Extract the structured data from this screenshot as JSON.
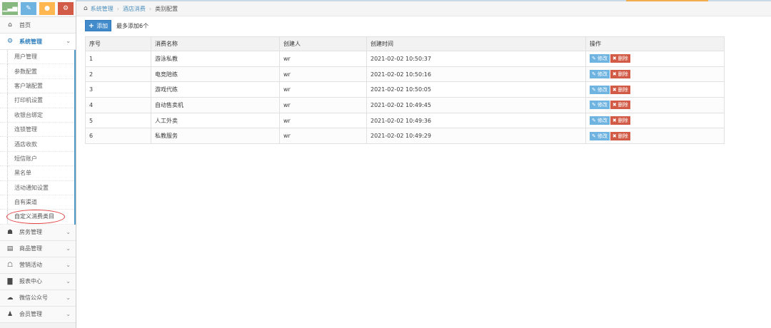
{
  "shortcuts": [
    {
      "icon": "chart-icon",
      "glyph": "▁▃▅",
      "color": "#87b87f"
    },
    {
      "icon": "pencil-icon",
      "glyph": "✎",
      "color": "#6fb3e0"
    },
    {
      "icon": "users-icon",
      "glyph": "●",
      "color": "#ffb752"
    },
    {
      "icon": "cogs-icon",
      "glyph": "⚙",
      "color": "#d15b47"
    }
  ],
  "nav": {
    "home": {
      "label": "首页",
      "icon": "home-icon",
      "glyph": "⌂"
    },
    "system": {
      "label": "系统管理",
      "icon": "gear-icon",
      "glyph": "⚙",
      "chevron": "⌄"
    },
    "sub_items": [
      "用户管理",
      "参数配置",
      "客户端配置",
      "打印机设置",
      "收银台绑定",
      "连锁管理",
      "酒店收款",
      "短信账户",
      "黑名单",
      "活动通知设置",
      "自有渠道",
      "自定义消费类目"
    ],
    "groups": [
      {
        "label": "房务管理",
        "icon": "bank-icon",
        "glyph": "☗"
      },
      {
        "label": "商品管理",
        "icon": "database-icon",
        "glyph": "▤"
      },
      {
        "label": "营销活动",
        "icon": "gift-icon",
        "glyph": "☖"
      },
      {
        "label": "报表中心",
        "icon": "bar-chart-icon",
        "glyph": "▇"
      },
      {
        "label": "微信公众号",
        "icon": "cloud-icon",
        "glyph": "☁"
      },
      {
        "label": "会员管理",
        "icon": "group-icon",
        "glyph": "♟"
      }
    ],
    "chevron": "⌄"
  },
  "breadcrumb": {
    "home_glyph": "⌂",
    "items": [
      "系统管理",
      "酒店消费",
      "类别配置"
    ],
    "separator": "›"
  },
  "toolbar": {
    "add_label": "添加",
    "add_glyph": "+",
    "hint": "最多添加6个"
  },
  "table": {
    "headers": [
      "序号",
      "消费名称",
      "创建人",
      "创建时间",
      "操作"
    ],
    "rows": [
      {
        "no": "1",
        "name": "游泳私教",
        "creator": "wr",
        "time": "2021-02-02 10:50:37"
      },
      {
        "no": "2",
        "name": "电竞陪练",
        "creator": "wr",
        "time": "2021-02-02 10:50:16"
      },
      {
        "no": "3",
        "name": "游戏代练",
        "creator": "wr",
        "time": "2021-02-02 10:50:05"
      },
      {
        "no": "4",
        "name": "自动售卖机",
        "creator": "wr",
        "time": "2021-02-02 10:49:45"
      },
      {
        "no": "5",
        "name": "人工外卖",
        "creator": "wr",
        "time": "2021-02-02 10:49:36"
      },
      {
        "no": "6",
        "name": "私教服务",
        "creator": "wr",
        "time": "2021-02-02 10:49:29"
      }
    ],
    "edit_label": "修改",
    "edit_glyph": "✎",
    "delete_label": "删除",
    "delete_glyph": "✖"
  },
  "colors": {
    "primary": "#428bca",
    "edit": "#6fb3e0",
    "delete": "#d15b47",
    "highlight_ring": "#e04040"
  }
}
